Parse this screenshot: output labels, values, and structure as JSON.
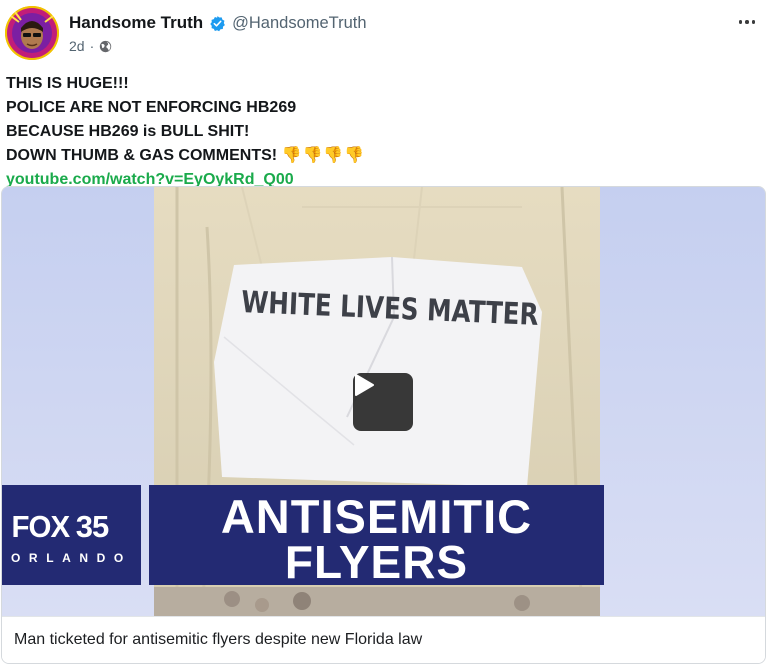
{
  "post": {
    "author_name": "Handsome Truth",
    "author_handle": "@HandsomeTruth",
    "time": "2d",
    "separator": "·",
    "text_lines": [
      "THIS IS HUGE!!!",
      "POLICE ARE NOT ENFORCING HB269",
      "BECAUSE HB269 is BULL SHIT!",
      "DOWN THUMB & GAS COMMENTS!"
    ],
    "emoji": "👎👎👎👎",
    "link": "youtube.com/watch?v=EyOykRd_Q00"
  },
  "video": {
    "sign_text": "WHITE LIVES MATTER",
    "channel_logo": "FOX 35",
    "channel_logo_word": "FOX",
    "channel_logo_num": "35",
    "channel_city": "ORLANDO",
    "headline_line1": "ANTISEMITIC",
    "headline_line2": "FLYERS",
    "caption": "Man ticketed for antisemitic flyers despite new Florida law"
  },
  "icons": {
    "verified": "verified-check-icon",
    "privacy": "globe-icon",
    "more": "more-options-icon",
    "play": "play-icon"
  },
  "colors": {
    "verified": "#1d9bf0",
    "link": "#1aaa4b",
    "fox_blue": "#232a73"
  }
}
